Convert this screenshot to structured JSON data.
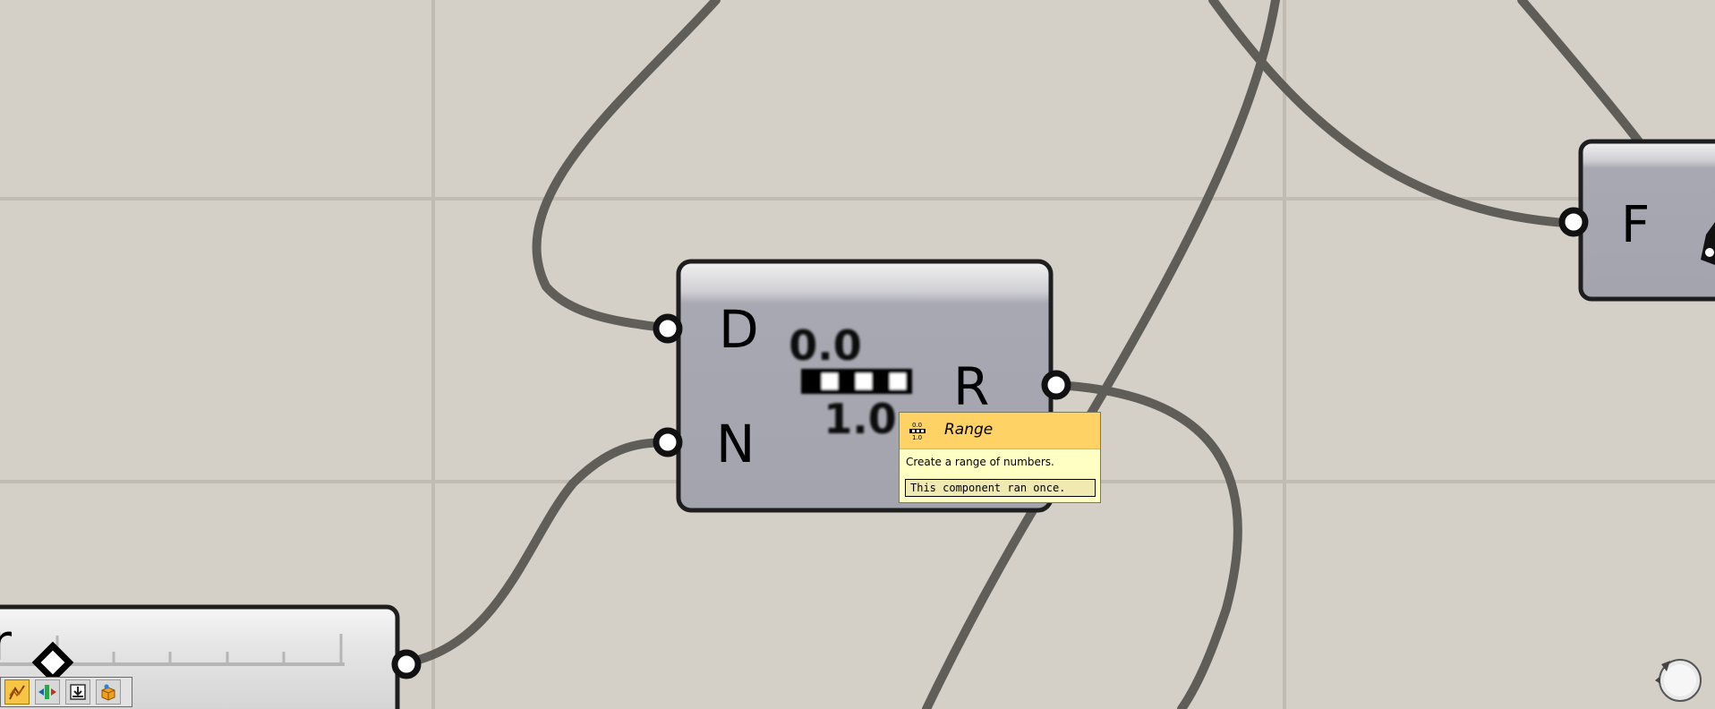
{
  "canvas": {
    "background": "#d4d0c8",
    "grid_color": "#c0bcb4",
    "wire_color": "#55544f"
  },
  "range_component": {
    "inputs": [
      "D",
      "N"
    ],
    "outputs": [
      "R"
    ],
    "icon_top_value": "0.0",
    "icon_bottom_value": "1.0"
  },
  "slider_component": {
    "partial_label": "r",
    "icon": "diamond-handle-icon"
  },
  "right_component": {
    "input": "F"
  },
  "tooltip": {
    "title": "Range",
    "description": "Create a range of numbers.",
    "status": "This component ran once.",
    "icon": "range-icon",
    "header_color": "#ffd266"
  },
  "toolbar": {
    "buttons": [
      "preview-icon",
      "flip-arrows-icon",
      "bake-icon",
      "box-icon"
    ]
  },
  "status_badge": {
    "icon": "gear-badge-icon"
  }
}
